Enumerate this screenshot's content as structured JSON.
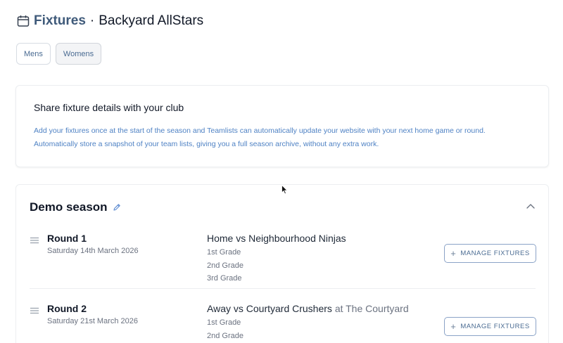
{
  "header": {
    "title": "Fixtures",
    "separator": "·",
    "club": "Backyard AllStars",
    "icon": "calendar-icon"
  },
  "tabs": [
    {
      "label": "Mens",
      "active": false
    },
    {
      "label": "Womens",
      "active": true
    }
  ],
  "info": {
    "title": "Share fixture details with your club",
    "line1": "Add your fixtures once at the start of the season and Teamlists can automatically update your website with your next home game or round.",
    "line2": "Automatically store a snapshot of your team lists, giving you a full season archive, without any extra work."
  },
  "season": {
    "name": "Demo season",
    "rounds": [
      {
        "name": "Round 1",
        "date": "Saturday 14th March 2026",
        "match": "Home vs Neighbourhood Ninjas",
        "venue": "",
        "grades": [
          "1st Grade",
          "2nd Grade",
          "3rd Grade"
        ],
        "button": "MANAGE FIXTURES"
      },
      {
        "name": "Round 2",
        "date": "Saturday 21st March 2026",
        "match": "Away vs Courtyard Crushers",
        "venue": "at The Courtyard",
        "grades": [
          "1st Grade",
          "2nd Grade"
        ],
        "button": "MANAGE FIXTURES"
      }
    ]
  },
  "colors": {
    "accent": "#3f5a7a",
    "link": "#4f82c4",
    "border": "#eceef1"
  }
}
